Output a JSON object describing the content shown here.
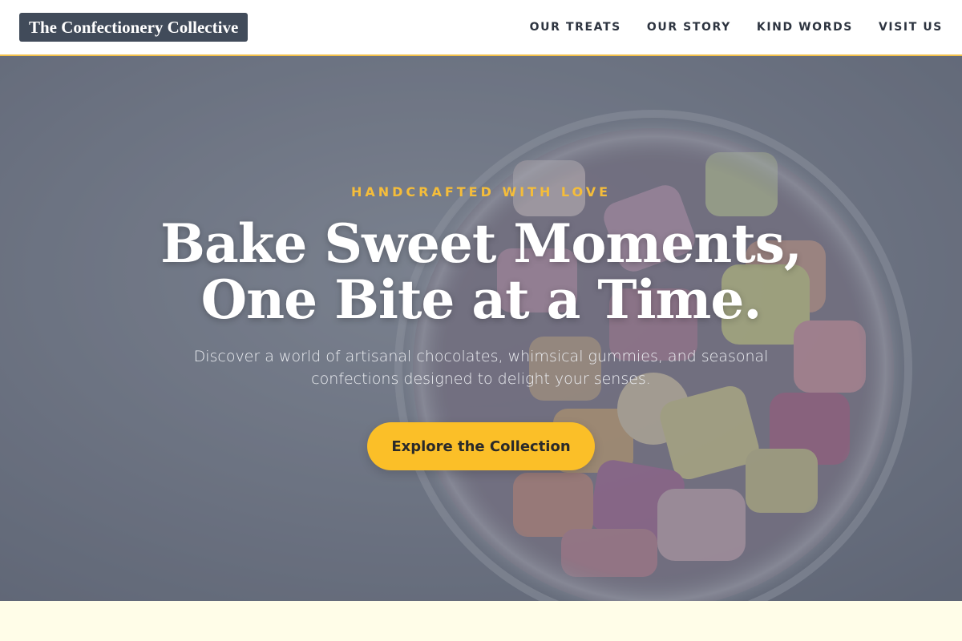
{
  "header": {
    "brand": "The Confectionery Collective",
    "nav": [
      {
        "label": "OUR TREATS"
      },
      {
        "label": "OUR STORY"
      },
      {
        "label": "KIND WORDS"
      },
      {
        "label": "VISIT US"
      }
    ]
  },
  "hero": {
    "eyebrow": "HANDCRAFTED WITH LOVE",
    "title_line1": "Bake Sweet Moments,",
    "title_line2": "One Bite at a Time.",
    "subtitle": "Discover a world of artisanal chocolates, whimsical gummies, and seasonal confections designed to delight your senses.",
    "cta_label": "Explore the Collection",
    "background_image": "candy-jar-photo"
  },
  "colors": {
    "accent": "#fbbf28",
    "eyebrow": "#f5bd3a",
    "brand_bg": "#414b5a",
    "page_bg": "#fffde8"
  }
}
